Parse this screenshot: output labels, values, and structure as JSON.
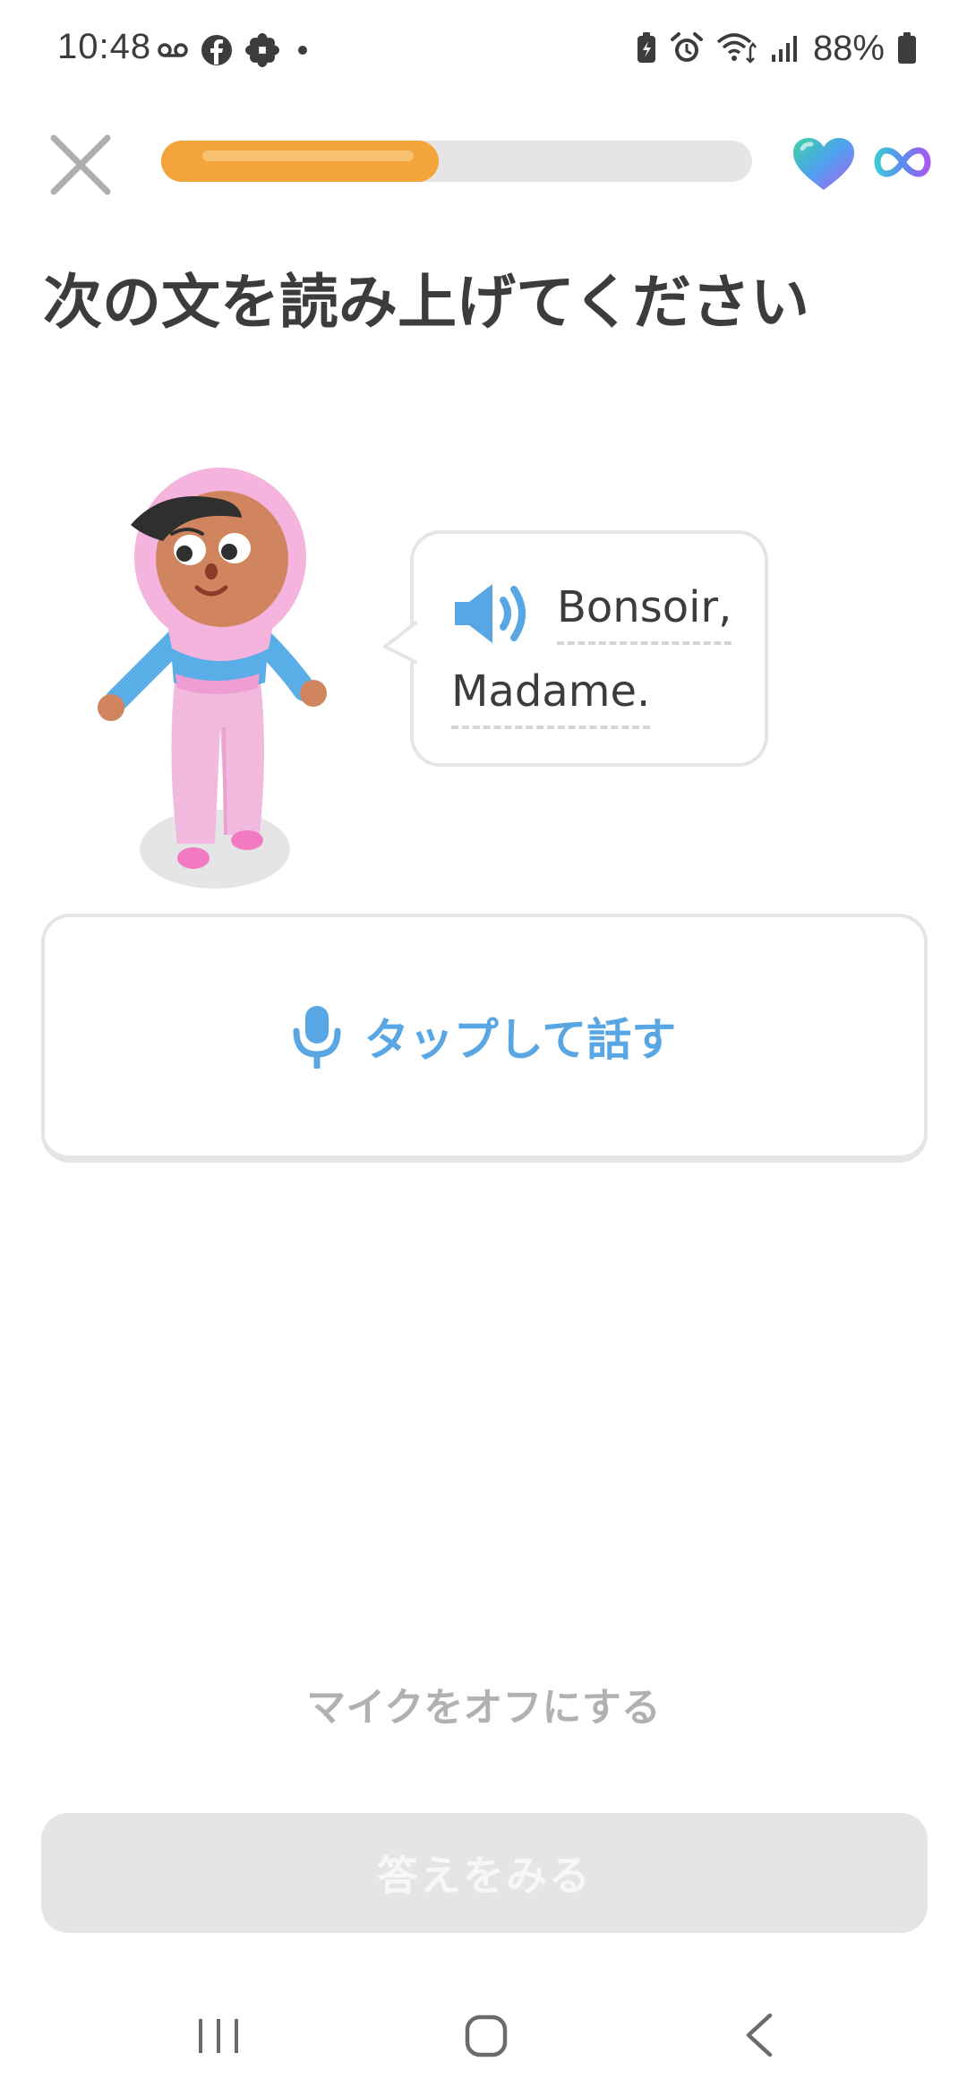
{
  "status_bar": {
    "time": "10:48",
    "left_icons": [
      "voicemail-icon",
      "facebook-icon",
      "flower-icon",
      "dot-icon"
    ],
    "right_icons": [
      "battery-saver-icon",
      "alarm-icon",
      "wifi-icon",
      "signal-icon",
      "battery-icon"
    ],
    "battery_percent": "88%"
  },
  "header": {
    "close_icon": "close-icon",
    "progress": 0.47,
    "hearts_icon": "heart-icon",
    "hearts_value": "infinity-icon",
    "colors": {
      "progress": "#f3a43a",
      "track": "#e5e5e5"
    }
  },
  "exercise": {
    "instruction": "次の文を読み上げてください",
    "speaker_icon": "speaker-icon",
    "phrase_words": [
      "Bonsoir,",
      "Madame."
    ]
  },
  "speak_button": {
    "icon": "microphone-icon",
    "label": "タップして話す",
    "color": "#58a7e4"
  },
  "mic_off_label": "マイクをオフにする",
  "check_button_label": "答えをみる",
  "nav_bar": {
    "icons": [
      "recent-apps-icon",
      "home-icon",
      "back-icon"
    ]
  }
}
